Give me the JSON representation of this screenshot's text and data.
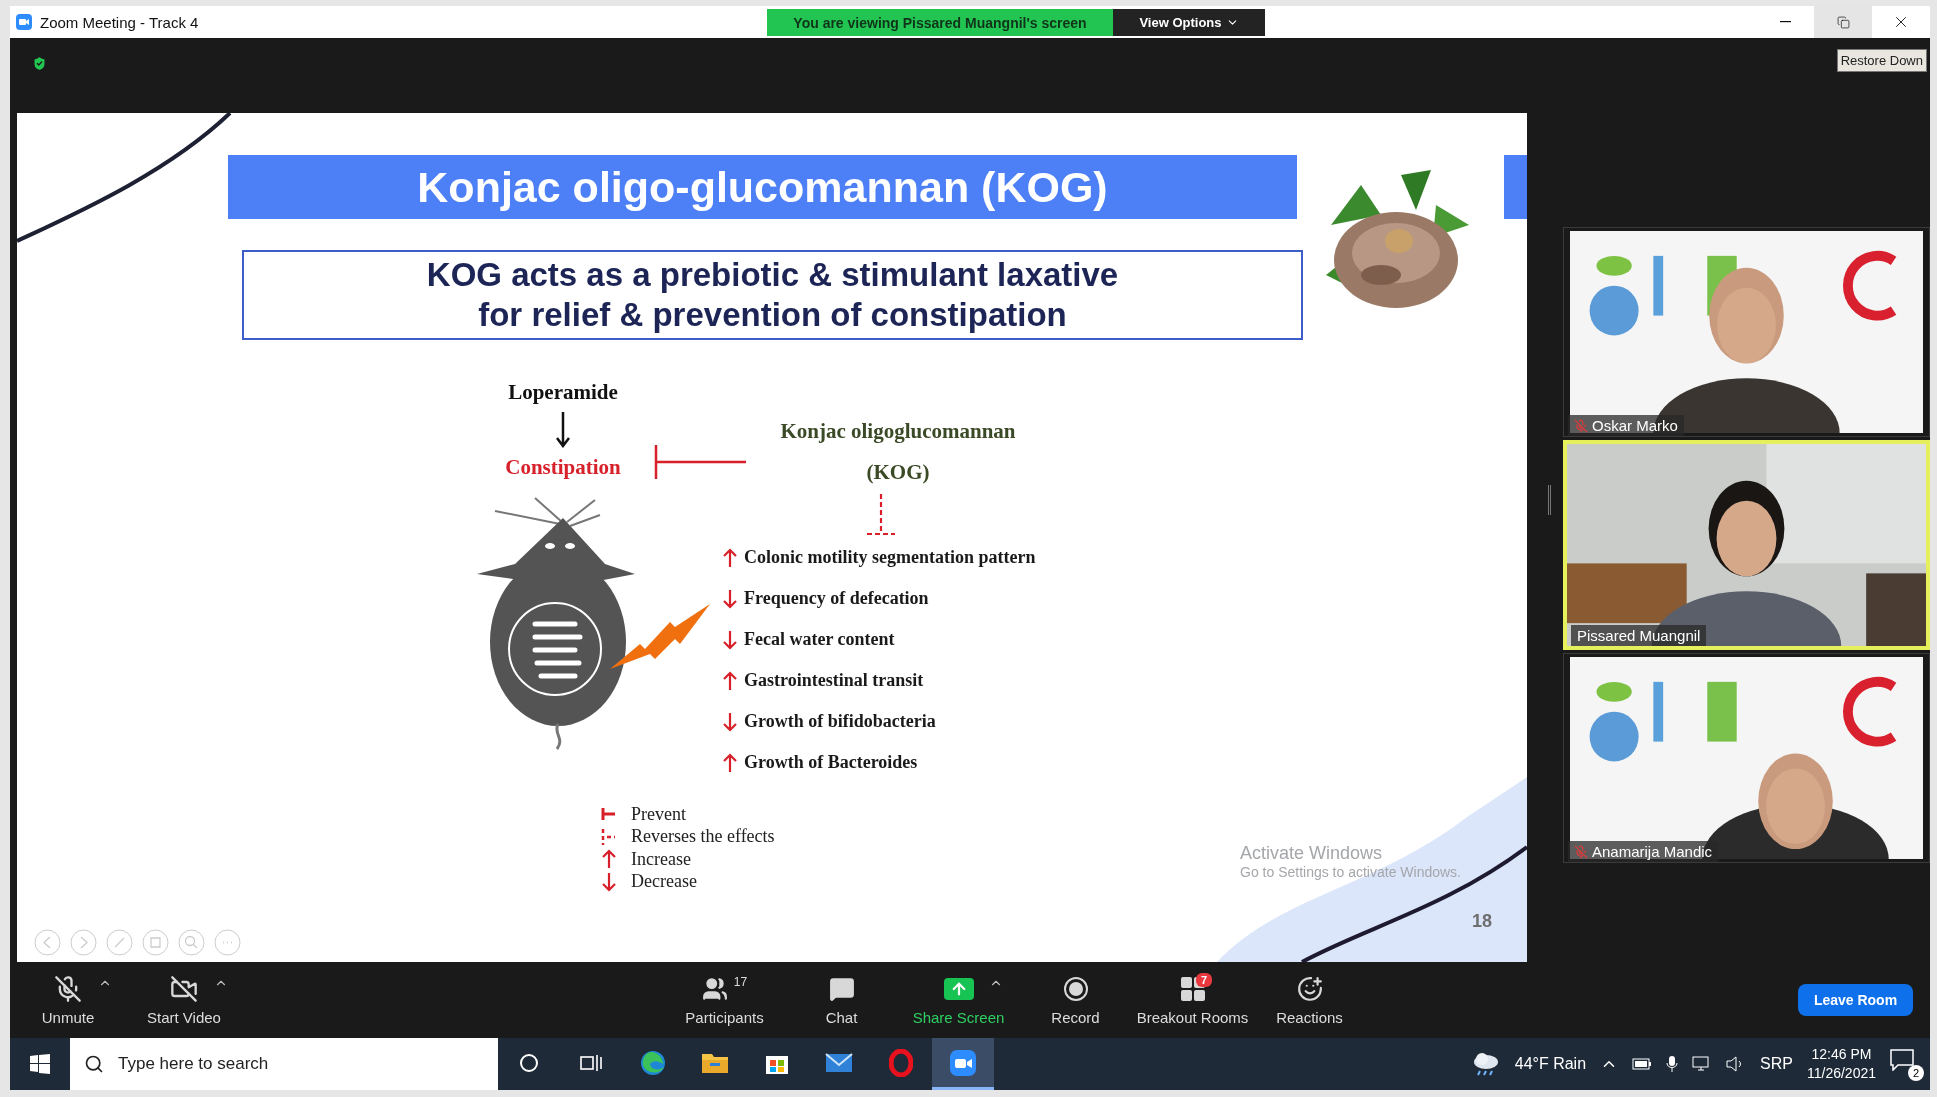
{
  "window": {
    "title": "Zoom Meeting - Track 4"
  },
  "share_banner": {
    "text": "You are viewing Pissared Muangnil's screen",
    "view_options": "View Options"
  },
  "tooltip": "Restore Down",
  "slide": {
    "title": "Konjac oligo-glucomannan (KOG)",
    "subtitle_lines": [
      "KOG acts as a prebiotic & stimulant laxative",
      "for relief & prevention of constipation"
    ],
    "diagram": {
      "cause": "Loperamide",
      "condition": "Constipation",
      "agent": "Konjac oligoglucomannan",
      "agent_abbr": "(KOG)",
      "effects": [
        {
          "kind": "up",
          "text": "Colonic motility segmentation pattern"
        },
        {
          "kind": "down",
          "text": "Frequency of defecation"
        },
        {
          "kind": "down",
          "text": "Fecal water content"
        },
        {
          "kind": "up",
          "text": "Gastrointestinal transit"
        },
        {
          "kind": "down",
          "text": "Growth of bifidobacteria"
        },
        {
          "kind": "up",
          "text": "Growth of Bacteroides"
        }
      ]
    },
    "legend": [
      {
        "kind": "prevent",
        "label": "Prevent"
      },
      {
        "kind": "reverse",
        "label": "Reverses the effects"
      },
      {
        "kind": "up",
        "label": "Increase"
      },
      {
        "kind": "down",
        "label": "Decrease"
      }
    ],
    "page_number": "18"
  },
  "activation_notice": {
    "title": "Activate Windows",
    "text": "Go to Settings to activate Windows."
  },
  "participants": [
    {
      "name": "Oskar Marko",
      "muted": true,
      "active_speaker": false
    },
    {
      "name": "Pissared Muangnil",
      "muted": false,
      "active_speaker": true
    },
    {
      "name": "Anamarija Mandic",
      "muted": true,
      "active_speaker": false
    }
  ],
  "toolbar": {
    "left": [
      {
        "kind": "mute",
        "label": "Unmute",
        "has_menu": true
      },
      {
        "kind": "video",
        "label": "Start Video",
        "has_menu": true
      }
    ],
    "center": [
      {
        "kind": "participants",
        "label": "Participants",
        "count": "17",
        "has_menu": false
      },
      {
        "kind": "chat",
        "label": "Chat",
        "has_menu": false
      },
      {
        "kind": "share",
        "label": "Share Screen",
        "has_menu": true
      },
      {
        "kind": "record",
        "label": "Record",
        "has_menu": false
      },
      {
        "kind": "breakout",
        "label": "Breakout Rooms",
        "count": "7",
        "has_menu": false
      },
      {
        "kind": "reactions",
        "label": "Reactions",
        "has_menu": false
      }
    ],
    "leave": "Leave Room"
  },
  "taskbar": {
    "search_placeholder": "Type here to search",
    "apps": [
      {
        "kind": "cortana",
        "selected": false
      },
      {
        "kind": "taskview",
        "selected": false
      },
      {
        "kind": "edge",
        "selected": false
      },
      {
        "kind": "explorer",
        "selected": false
      },
      {
        "kind": "store",
        "selected": false
      },
      {
        "kind": "mail",
        "selected": false
      },
      {
        "kind": "opera",
        "selected": false
      },
      {
        "kind": "zoom",
        "selected": true
      }
    ],
    "weather": "44°F  Rain",
    "language": "SRP",
    "time": "12:46 PM",
    "date": "11/26/2021",
    "notification_count": "2"
  }
}
